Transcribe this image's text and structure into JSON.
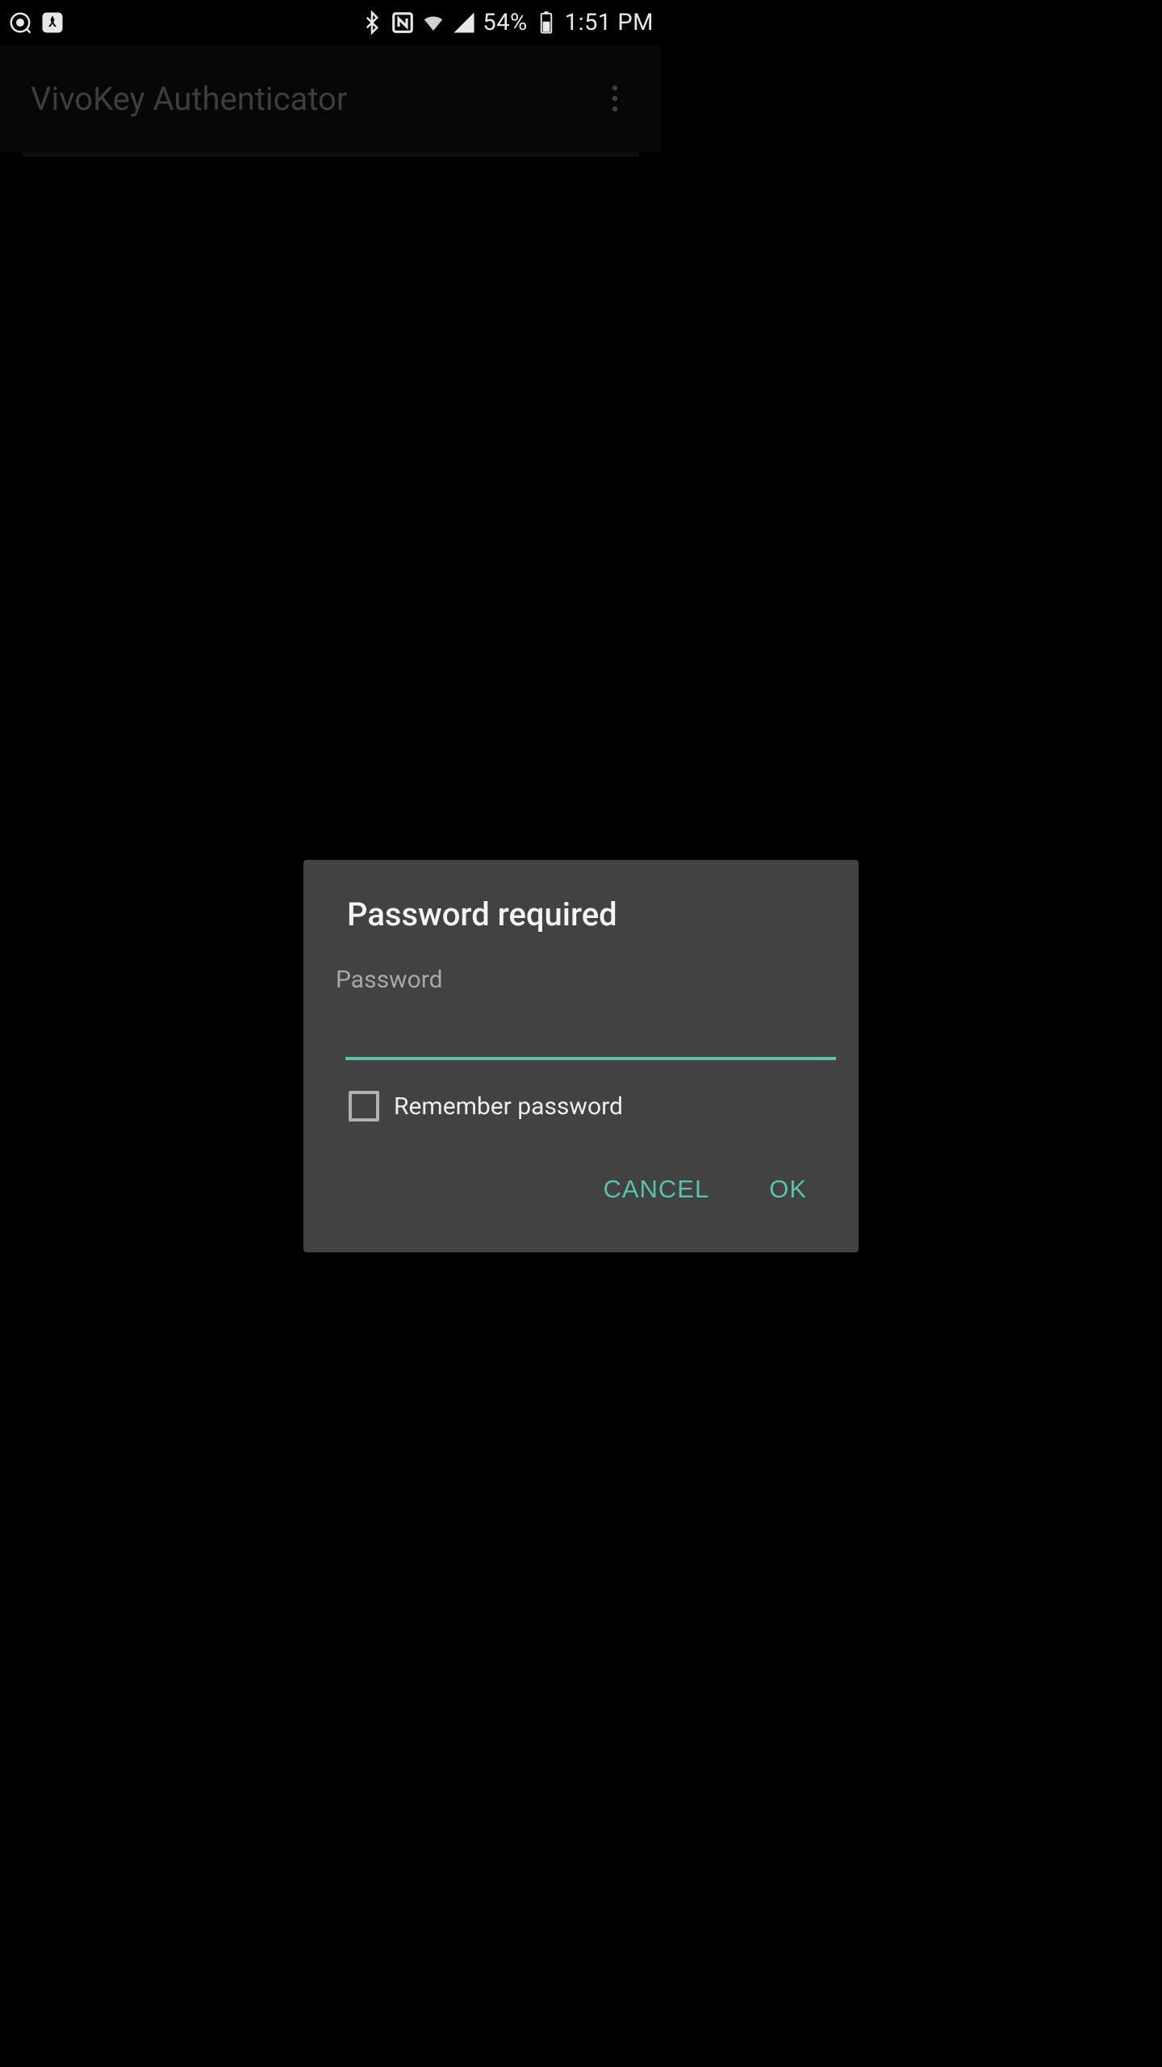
{
  "statusbar": {
    "battery_pct": "54%",
    "clock": "1:51 PM"
  },
  "appbar": {
    "title": "VivoKey Authenticator"
  },
  "dialog": {
    "title": "Password required",
    "password_label": "Password",
    "password_value": "",
    "remember_label": "Remember password",
    "cancel_label": "CANCEL",
    "ok_label": "OK"
  }
}
